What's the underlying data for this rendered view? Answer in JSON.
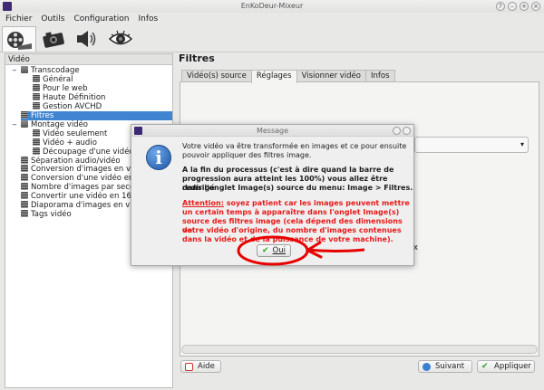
{
  "window": {
    "title": "EnKoDeur-Mixeur"
  },
  "menu": [
    "Fichier",
    "Outils",
    "Configuration",
    "Infos"
  ],
  "toolbar": {
    "icons": [
      "film-reel-icon",
      "camera-icon",
      "speaker-icon",
      "eye-icon"
    ]
  },
  "left_panel": {
    "header": "Vidéo",
    "tree": [
      {
        "label": "Transcodage",
        "level": 0,
        "expander": "−",
        "icon": "folder"
      },
      {
        "label": "Général",
        "level": 1,
        "icon": "film"
      },
      {
        "label": "Pour le web",
        "level": 1,
        "icon": "film"
      },
      {
        "label": "Haute Définition",
        "level": 1,
        "icon": "film"
      },
      {
        "label": "Gestion AVCHD",
        "level": 1,
        "icon": "film"
      },
      {
        "label": "Filtres",
        "level": 0,
        "icon": "film",
        "selected": true
      },
      {
        "label": "Montage vidéo",
        "level": 0,
        "expander": "−",
        "icon": "folder"
      },
      {
        "label": "Vidéo seulement",
        "level": 1,
        "icon": "film"
      },
      {
        "label": "Vidéo + audio",
        "level": 1,
        "icon": "film"
      },
      {
        "label": "Découpage d'une vidéo",
        "level": 1,
        "icon": "film"
      },
      {
        "label": "Séparation audio/vidéo",
        "level": 0,
        "icon": "film"
      },
      {
        "label": "Conversion d'images en vidé",
        "level": 0,
        "icon": "film"
      },
      {
        "label": "Conversion d'une vidéo en im",
        "level": 0,
        "icon": "film"
      },
      {
        "label": "Nombre d'images par second",
        "level": 0,
        "icon": "film"
      },
      {
        "label": "Convertir une vidéo en 16/9 c",
        "level": 0,
        "icon": "film"
      },
      {
        "label": "Diaporama d'images en vidéo",
        "level": 0,
        "icon": "film"
      },
      {
        "label": "Tags vidéo",
        "level": 0,
        "icon": "film"
      }
    ]
  },
  "main": {
    "title": "Filtres",
    "tabs": [
      {
        "label": "Vidéo(s) source",
        "active": false
      },
      {
        "label": "Réglages",
        "active": true
      },
      {
        "label": "Visionner vidéo",
        "active": false
      },
      {
        "label": "Infos",
        "active": false
      }
    ],
    "partial_label": "x",
    "buttons": {
      "help": "Aide",
      "next": "Suivant",
      "apply": "Appliquer"
    }
  },
  "dialog": {
    "title": "Message",
    "line1": "Votre vidéo va être transformée en images et ce pour ensuite",
    "line2": "pouvoir appliquer des filtres image.",
    "bold1": "A la fin du processus (c'est à dire quand la barre de",
    "bold2": "progression aura atteint les 100%) vous allez être redirigé",
    "bold3": "dans l'onglet Image(s) source du menu: Image > Filtres.",
    "warn_prefix": "Attention:",
    "warn1": " soyez patient car les images peuvent mettre",
    "warn2": "un certain temps à apparaître dans l'onglet Image(s)",
    "warn3": "source des filtres image (cela dépend des dimensions de",
    "warn4": "votre vidéo d'origine, du nombre d'images contenues",
    "warn5": "dans la vidéo et de la puissance de votre machine).",
    "ok_label": "Oui"
  },
  "colors": {
    "selection": "#3f85d1",
    "warning_text": "#e81a1a",
    "annotation": "#e60000"
  }
}
